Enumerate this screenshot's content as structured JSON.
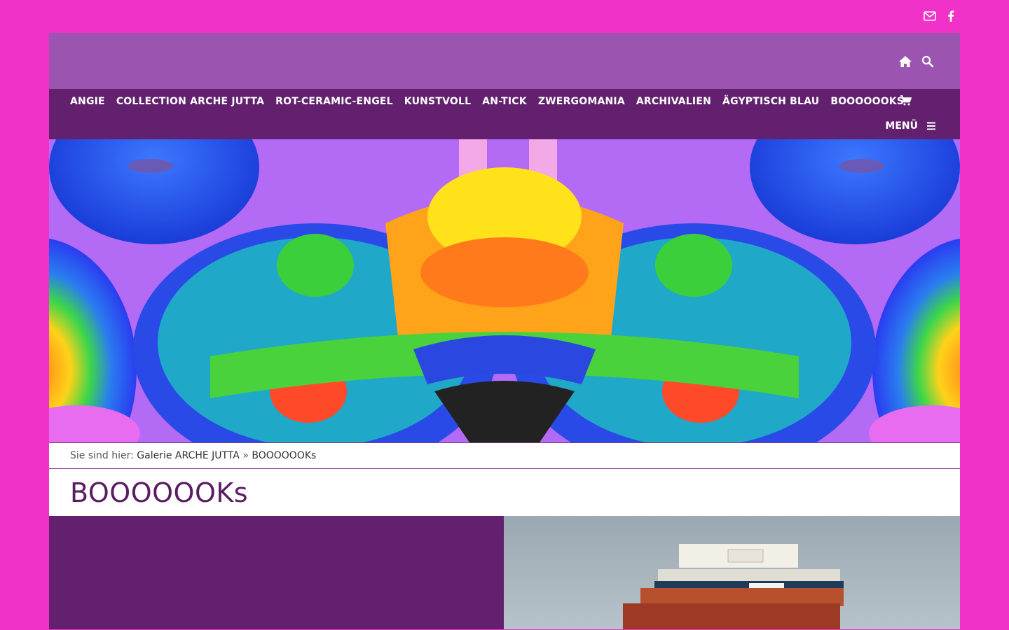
{
  "topbar": {
    "icons": [
      "mail-icon",
      "facebook-icon"
    ],
    "bg_color": "#f032c8"
  },
  "header": {
    "icons": [
      "home-icon",
      "search-icon"
    ],
    "bg_color": "#9b55b1"
  },
  "nav": {
    "bg_color": "#62206f",
    "items": [
      {
        "label": "ANGIE"
      },
      {
        "label": "COLLECTION ARCHE JUTTA"
      },
      {
        "label": "ROT-CERAMIC-ENGEL"
      },
      {
        "label": "KUNSTVOLL"
      },
      {
        "label": "AN-TICK"
      },
      {
        "label": "ZWERGOMANIA"
      },
      {
        "label": "ARCHIVALIEN"
      },
      {
        "label": "ÄGYPTISCH BLAU"
      },
      {
        "label": "BOOOOOOKS"
      }
    ],
    "cart_icon": "cart-icon",
    "menu_label": "MENÜ",
    "menu_icon": "hamburger-icon"
  },
  "hero": {
    "description_icon": "psychedelic-mirrored-art-banner"
  },
  "breadcrumb": {
    "prefix": "Sie sind hier:",
    "home": "Galerie ARCHE JUTTA",
    "separator": "»",
    "current": "BOOOOOOKs"
  },
  "page": {
    "title": "BOOOOOOKs"
  },
  "colors": {
    "accent": "#62206f",
    "title": "#5a1d63"
  }
}
